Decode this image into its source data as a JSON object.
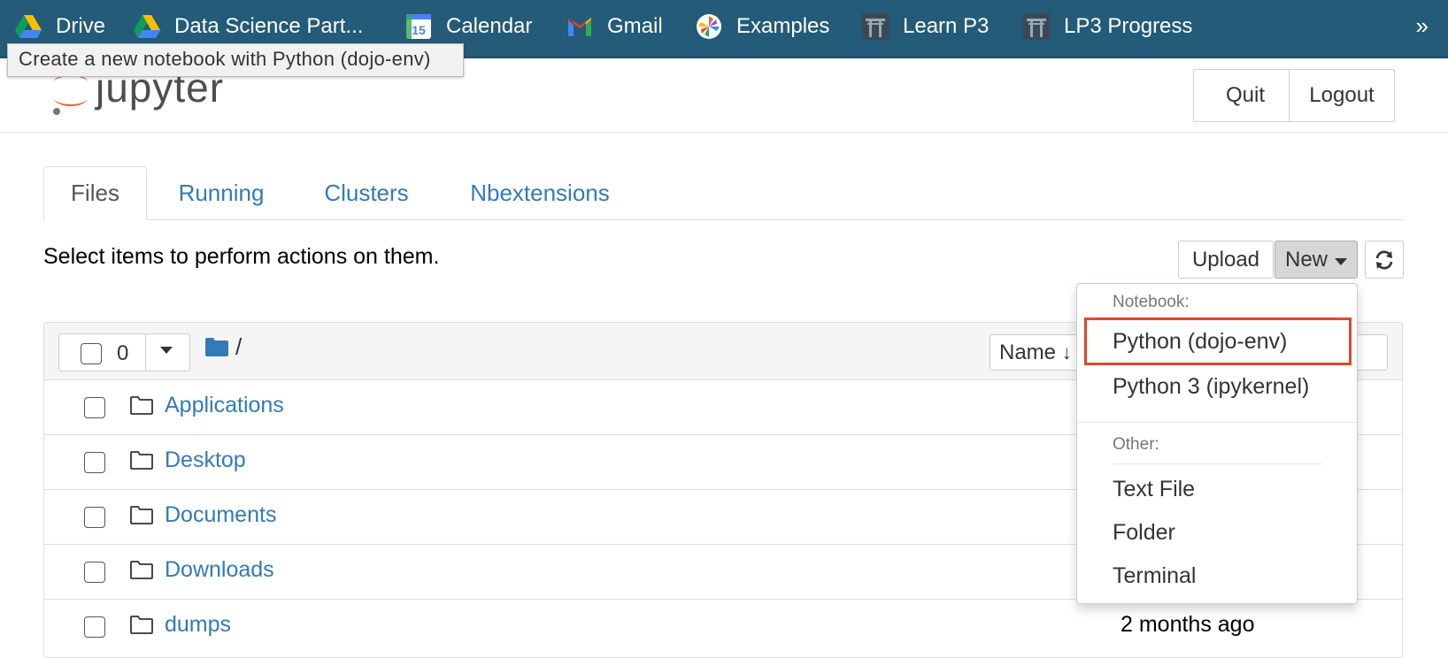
{
  "bookmarks": {
    "items": [
      {
        "label": "Drive",
        "icon": "google-drive-icon"
      },
      {
        "label": "Data Science Part...",
        "icon": "google-drive-icon"
      },
      {
        "label": "Calendar",
        "icon": "calendar-icon",
        "badge": "15"
      },
      {
        "label": "Gmail",
        "icon": "gmail-icon"
      },
      {
        "label": "Examples",
        "icon": "pinwheel-icon"
      },
      {
        "label": "Learn P3",
        "icon": "torii-icon"
      },
      {
        "label": "LP3 Progress",
        "icon": "torii-icon"
      }
    ],
    "more": "»"
  },
  "tooltip": "Create a new notebook with Python (dojo-env)",
  "header": {
    "logo_text": "jupyter",
    "quit": "Quit",
    "logout": "Logout"
  },
  "tabs": [
    "Files",
    "Running",
    "Clusters",
    "Nbextensions"
  ],
  "hint": "Select items to perform actions on them.",
  "toolbar": {
    "upload": "Upload",
    "new": "New",
    "refresh_icon": "refresh-icon"
  },
  "list": {
    "selected_count": "0",
    "path": "/",
    "sort_label": "Name",
    "rows": [
      {
        "name": "Applications",
        "time": ""
      },
      {
        "name": "Desktop",
        "time": ""
      },
      {
        "name": "Documents",
        "time": ""
      },
      {
        "name": "Downloads",
        "time": ""
      },
      {
        "name": "dumps",
        "time": "2 months ago"
      }
    ]
  },
  "new_menu": {
    "notebook_header": "Notebook:",
    "notebooks": [
      "Python (dojo-env)",
      "Python 3 (ipykernel)"
    ],
    "other_header": "Other:",
    "others": [
      "Text File",
      "Folder",
      "Terminal"
    ]
  },
  "colors": {
    "bookmark_bar": "#235b78",
    "link": "#337ab7",
    "highlight": "#e0452f",
    "jupyter_orange": "#e46e2e"
  }
}
